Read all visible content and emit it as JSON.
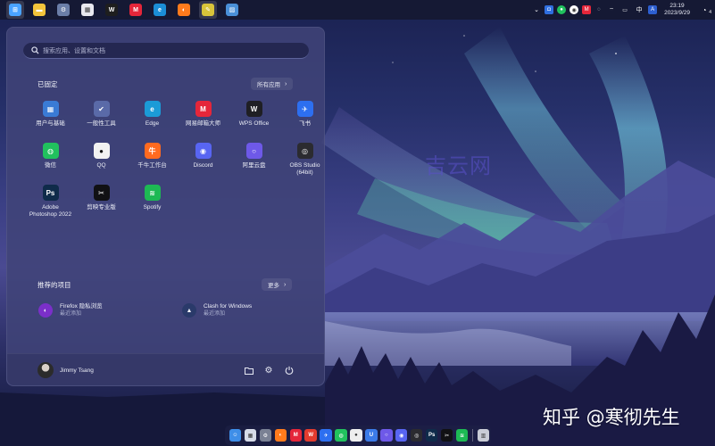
{
  "colors": {
    "accent": "#4f7df2",
    "start_bg": "#404478",
    "taskbar_bg": "#141830"
  },
  "topbar": {
    "apps": [
      {
        "name": "start-button",
        "icon": "windows-logo-icon",
        "color": "#4aa3ff",
        "active": true
      },
      {
        "name": "file-explorer",
        "icon": "folder-icon",
        "color": "#f3c43b",
        "active": false
      },
      {
        "name": "settings",
        "icon": "gear-icon",
        "color": "#6b7ea8",
        "active": false
      },
      {
        "name": "microsoft-store",
        "icon": "store-icon",
        "color": "#e9e9ef",
        "active": false
      },
      {
        "name": "wps-office",
        "icon": "wps-icon",
        "color": "#1e1e1e",
        "active": false
      },
      {
        "name": "netease-mail",
        "icon": "mail-master-icon",
        "color": "#e5263a",
        "active": false
      },
      {
        "name": "edge",
        "icon": "edge-icon",
        "color": "#1b8ed6",
        "active": false
      },
      {
        "name": "firefox",
        "icon": "firefox-icon",
        "color": "#ff7b1c",
        "active": false
      },
      {
        "name": "notes",
        "icon": "notes-icon",
        "color": "#d8c43a",
        "active": true
      },
      {
        "name": "photos",
        "icon": "photos-icon",
        "color": "#4a90d8",
        "active": false
      }
    ],
    "tray": {
      "ime": "中",
      "time": "23:19",
      "date": "2023/9/29",
      "notification_count": "4"
    }
  },
  "start_menu": {
    "search_placeholder": "搜索应用、设置和文档",
    "pinned_title": "已固定",
    "all_apps_label": "所有应用",
    "pinned_apps": [
      {
        "label": "用户与基础",
        "icon": "user-basics-icon",
        "color": "#3a7bd5",
        "glyph": "▦"
      },
      {
        "label": "一般性工具",
        "icon": "general-tools-icon",
        "color": "#5a6aa8",
        "glyph": "✔"
      },
      {
        "label": "Edge",
        "icon": "edge-icon",
        "color": "#1b9bd7",
        "glyph": "e"
      },
      {
        "label": "网易邮箱大师",
        "icon": "netease-mail-icon",
        "color": "#e5263a",
        "glyph": "M"
      },
      {
        "label": "WPS Office",
        "icon": "wps-office-icon",
        "color": "#1f1f24",
        "glyph": "W"
      },
      {
        "label": "飞书",
        "icon": "feishu-icon",
        "color": "#2d6ff0",
        "glyph": "✈"
      },
      {
        "label": "微信",
        "icon": "wechat-icon",
        "color": "#21c15e",
        "glyph": "◍"
      },
      {
        "label": "QQ",
        "icon": "qq-icon",
        "color": "#f2f2f2",
        "glyph": "●"
      },
      {
        "label": "千牛工作台",
        "icon": "qianniu-icon",
        "color": "#ff6a1f",
        "glyph": "牛"
      },
      {
        "label": "Discord",
        "icon": "discord-icon",
        "color": "#5865f2",
        "glyph": "◉"
      },
      {
        "label": "阿里云盘",
        "icon": "aliyun-drive-icon",
        "color": "#6e59e8",
        "glyph": "○"
      },
      {
        "label": "OBS Studio\n(64bit)",
        "icon": "obs-studio-icon",
        "color": "#2b2b30",
        "glyph": "◎"
      },
      {
        "label": "Adobe\nPhotoshop 2022",
        "icon": "photoshop-icon",
        "color": "#0f2b4a",
        "glyph": "Ps"
      },
      {
        "label": "剪映专业版",
        "icon": "jianying-icon",
        "color": "#111114",
        "glyph": "✂"
      },
      {
        "label": "Spotify",
        "icon": "spotify-icon",
        "color": "#1db954",
        "glyph": "≋"
      }
    ],
    "recommended_title": "推荐的项目",
    "more_label": "更多",
    "recommended": [
      {
        "name": "Firefox 隐私浏览",
        "sub": "最近添加",
        "icon": "firefox-private-icon",
        "color": "#7b2fc9"
      },
      {
        "name": "Clash for Windows",
        "sub": "最近添加",
        "icon": "clash-icon",
        "color": "#2a3a6a"
      }
    ],
    "user_name": "Jimmy Tsang"
  },
  "watermarks": {
    "center": "吉云网",
    "zhihu": "知乎 @寒彻先生"
  },
  "dock": {
    "items": [
      {
        "icon": "finder-icon",
        "color": "#3e8ee8",
        "glyph": "☺"
      },
      {
        "icon": "launchpad-icon",
        "color": "#d6dbe8",
        "glyph": "▦"
      },
      {
        "icon": "settings-icon",
        "color": "#7a8194",
        "glyph": "⚙"
      },
      {
        "icon": "firefox-icon",
        "color": "#ff7b1c",
        "glyph": "◐"
      },
      {
        "icon": "netease-mail-icon",
        "color": "#e5263a",
        "glyph": "M"
      },
      {
        "icon": "wps-icon",
        "color": "#e23b2e",
        "glyph": "W"
      },
      {
        "icon": "feishu-icon",
        "color": "#2d6ff0",
        "glyph": "✈"
      },
      {
        "icon": "wechat-icon",
        "color": "#21c15e",
        "glyph": "◍"
      },
      {
        "icon": "qq-icon",
        "color": "#eeeeee",
        "glyph": "●"
      },
      {
        "icon": "todo-icon",
        "color": "#3b7be8",
        "glyph": "U"
      },
      {
        "icon": "aliyun-drive-icon",
        "color": "#6e59e8",
        "glyph": "○"
      },
      {
        "icon": "discord-icon",
        "color": "#5865f2",
        "glyph": "◉"
      },
      {
        "icon": "obs-studio-icon",
        "color": "#2b2b30",
        "glyph": "◎"
      },
      {
        "icon": "photoshop-icon",
        "color": "#0f2b4a",
        "glyph": "Ps"
      },
      {
        "icon": "capcut-icon",
        "color": "#111114",
        "glyph": "✂"
      },
      {
        "icon": "spotify-icon",
        "color": "#1db954",
        "glyph": "≋"
      },
      {
        "icon": "trash-icon",
        "color": "#c9ccd6",
        "glyph": "▥"
      }
    ]
  }
}
